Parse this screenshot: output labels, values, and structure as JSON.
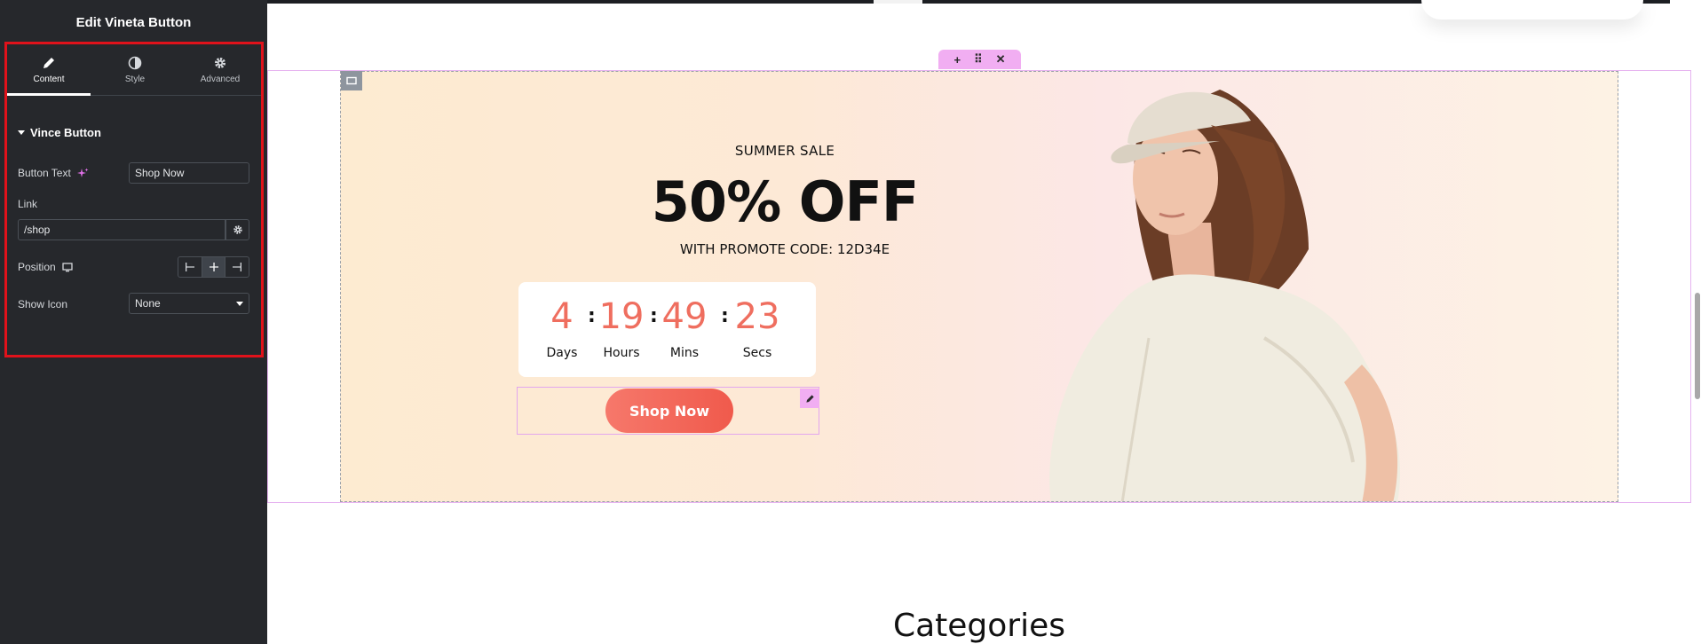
{
  "panel": {
    "title": "Edit Vineta Button",
    "tabs": [
      {
        "label": "Content",
        "icon": "pencil-icon"
      },
      {
        "label": "Style",
        "icon": "half-circle-icon"
      },
      {
        "label": "Advanced",
        "icon": "gear-icon"
      }
    ],
    "active_tab": "Content",
    "section_title": "Vince Button",
    "controls": {
      "button_text_label": "Button Text",
      "button_text_value": "Shop Now",
      "link_label": "Link",
      "link_value": "/shop",
      "position_label": "Position",
      "position_options": [
        "left",
        "center",
        "right"
      ],
      "position_selected": "center",
      "show_icon_label": "Show Icon",
      "show_icon_value": "None"
    },
    "highlight_color": "#e0121b"
  },
  "section_toolbar": {
    "add": "+",
    "move": "⠿",
    "close": "✕"
  },
  "banner": {
    "eyebrow": "SUMMER SALE",
    "headline": "50% OFF",
    "promo_code": "WITH PROMOTE CODE: 12D34E",
    "countdown": [
      {
        "value": "4",
        "label": "Days"
      },
      {
        "value": "19",
        "label": "Hours"
      },
      {
        "value": "49",
        "label": "Mins"
      },
      {
        "value": "23",
        "label": "Secs"
      }
    ],
    "button_label": "Shop Now",
    "accent_color": "#ef6e5f"
  },
  "next_section_title": "Categories"
}
